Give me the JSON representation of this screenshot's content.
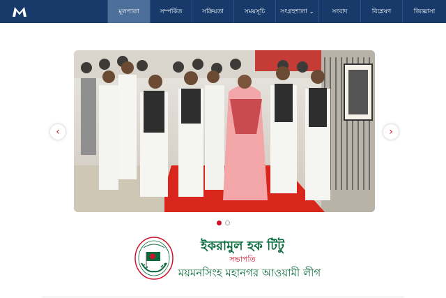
{
  "nav": {
    "logo_icon": "M-logo",
    "items": [
      {
        "label": "মূলপাতা",
        "active": true
      },
      {
        "label": "সম্পর্কিত",
        "active": false
      },
      {
        "label": "সক্রিয়তা",
        "active": false
      },
      {
        "label": "সময়সূচি",
        "active": false
      },
      {
        "label": "সংগ্রহশালা",
        "active": false,
        "dropdown": true
      },
      {
        "label": "সংবাদ",
        "active": false
      },
      {
        "label": "বিশ্লেষণ",
        "active": false
      },
      {
        "label": "জিজ্ঞাসা",
        "active": false
      }
    ]
  },
  "slider": {
    "prev_icon": "chevron-left-icon",
    "next_icon": "chevron-right-icon",
    "prev_glyph": "‹",
    "next_glyph": "›",
    "slide_count": 2,
    "active_slide": 1
  },
  "profile": {
    "name": "ইকরামুল হক টিটু",
    "title": "সভাপতি",
    "organization": "ময়মনসিংহ মহানগর আওয়ামী লীগ"
  },
  "colors": {
    "navbar": "#173a6b",
    "nav_active": "#4b6f99",
    "accent_red": "#d0112b",
    "accent_green": "#0a6b3d"
  }
}
